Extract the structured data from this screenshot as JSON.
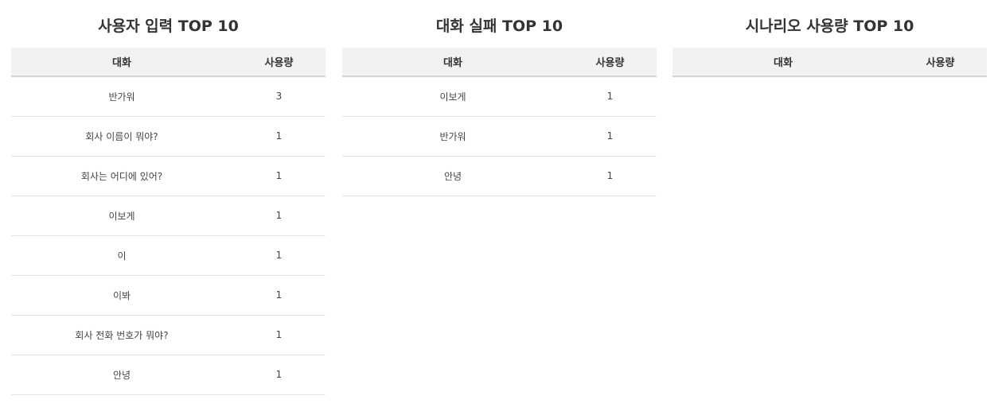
{
  "panels": [
    {
      "title": "사용자 입력 TOP 10",
      "headers": {
        "conversation": "대화",
        "usage": "사용량"
      },
      "rows": [
        {
          "conversation": "반가워",
          "usage": "3"
        },
        {
          "conversation": "회사 이름이 뭐야?",
          "usage": "1"
        },
        {
          "conversation": "회사는 어디에 있어?",
          "usage": "1"
        },
        {
          "conversation": "이보게",
          "usage": "1"
        },
        {
          "conversation": "이",
          "usage": "1"
        },
        {
          "conversation": "이봐",
          "usage": "1"
        },
        {
          "conversation": "회사 전화 번호가 뭐야?",
          "usage": "1"
        },
        {
          "conversation": "안녕",
          "usage": "1"
        }
      ]
    },
    {
      "title": "대화 실패 TOP 10",
      "headers": {
        "conversation": "대화",
        "usage": "사용량"
      },
      "rows": [
        {
          "conversation": "이보게",
          "usage": "1"
        },
        {
          "conversation": "반가워",
          "usage": "1"
        },
        {
          "conversation": "안녕",
          "usage": "1"
        }
      ]
    },
    {
      "title": "시나리오 사용량 TOP 10",
      "headers": {
        "conversation": "대화",
        "usage": "사용량"
      },
      "rows": []
    }
  ]
}
